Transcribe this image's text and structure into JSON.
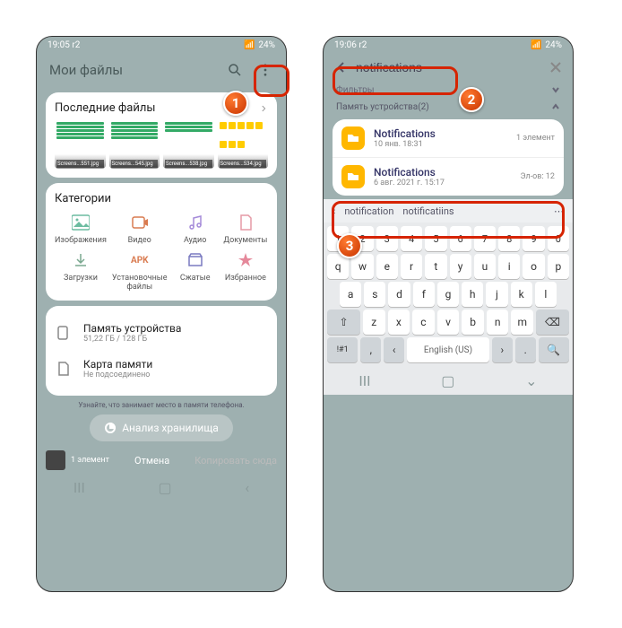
{
  "status": {
    "time_left": "19:05 r2",
    "time_right": "19:06 r2",
    "battery": "24%"
  },
  "left": {
    "title": "Мои файлы",
    "recent_title": "Последние файлы",
    "thumbs": [
      "Screens...551.jpg",
      "Screens...545.jpg",
      "Screens...538.jpg",
      "Screens...534.jpg"
    ],
    "cat_title": "Категории",
    "cats": [
      "Изображения",
      "Видео",
      "Аудио",
      "Документы",
      "Загрузки",
      "Установочные файлы",
      "Сжатые",
      "Избранное"
    ],
    "apk": "APK",
    "store1": {
      "t": "Память устройства",
      "s": "51,22 ГБ / 128 ГБ"
    },
    "store2": {
      "t": "Карта памяти",
      "s": "Не подсоединено"
    },
    "hint": "Узнайте, что занимает место в памяти телефона.",
    "btn": "Анализ хранилища",
    "sel": "1 элемент",
    "cancel": "Отмена",
    "copy": "Копировать сюда"
  },
  "right": {
    "query": "notifications",
    "filters": "Фильтры",
    "section": "Память устройства(2)",
    "r1": {
      "t": "Notifications",
      "s": "10 янв. 18:31",
      "m": "1 элемент"
    },
    "r2": {
      "t": "Notifications",
      "s": "6 авг. 2021 г. 15:17",
      "m": "Эл-ов: 12"
    },
    "sugg": [
      "notification",
      "notificatiins"
    ],
    "lang": "English (US)"
  }
}
